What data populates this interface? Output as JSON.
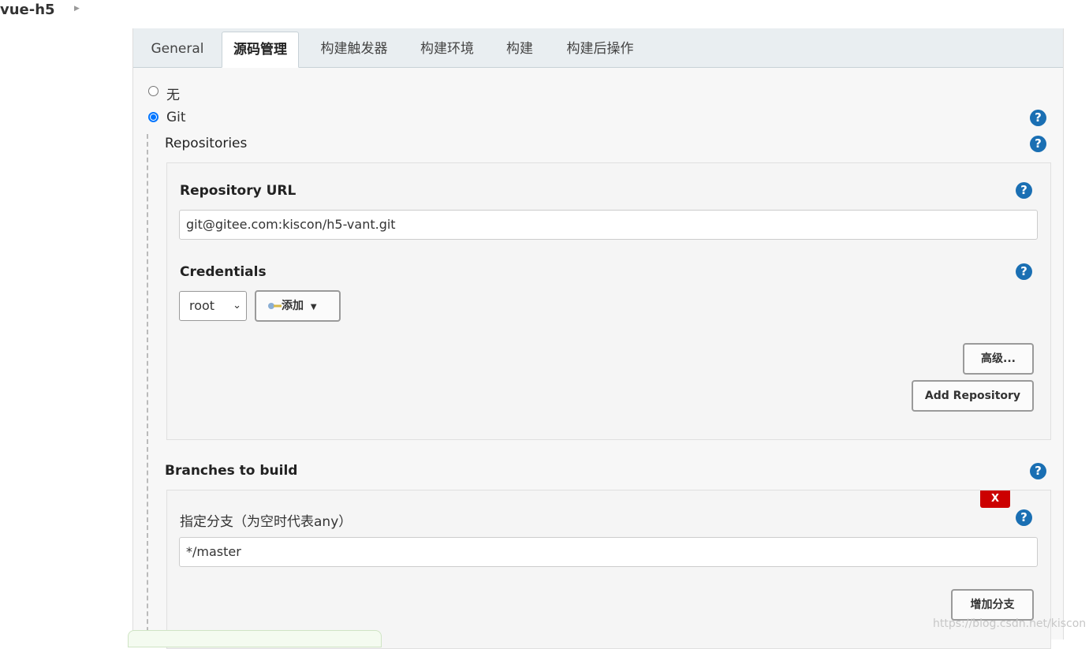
{
  "breadcrumb": {
    "project": "vue-h5"
  },
  "tabs": [
    {
      "label": "General"
    },
    {
      "label": "源码管理"
    },
    {
      "label": "构建触发器"
    },
    {
      "label": "构建环境"
    },
    {
      "label": "构建"
    },
    {
      "label": "构建后操作"
    }
  ],
  "scm": {
    "options": [
      {
        "label": "无",
        "selected": false
      },
      {
        "label": "Git",
        "selected": true
      }
    ]
  },
  "repositories": {
    "title": "Repositories",
    "url_label": "Repository URL",
    "url_value": "git@gitee.com:kiscon/h5-vant.git",
    "credentials_label": "Credentials",
    "credentials_selected": "root",
    "add_button": "添加",
    "advanced_button": "高级...",
    "add_repo_button": "Add Repository"
  },
  "branches": {
    "title": "Branches to build",
    "field_label": "指定分支（为空时代表any）",
    "field_value": "*/master",
    "delete_button": "X",
    "add_branch_button": "增加分支"
  },
  "help_glyph": "?",
  "watermark": "https://blog.csdn.net/kiscon",
  "colors": {
    "help": "#1a6fb3",
    "delete": "#cc0000",
    "radio": "#0075ff"
  }
}
